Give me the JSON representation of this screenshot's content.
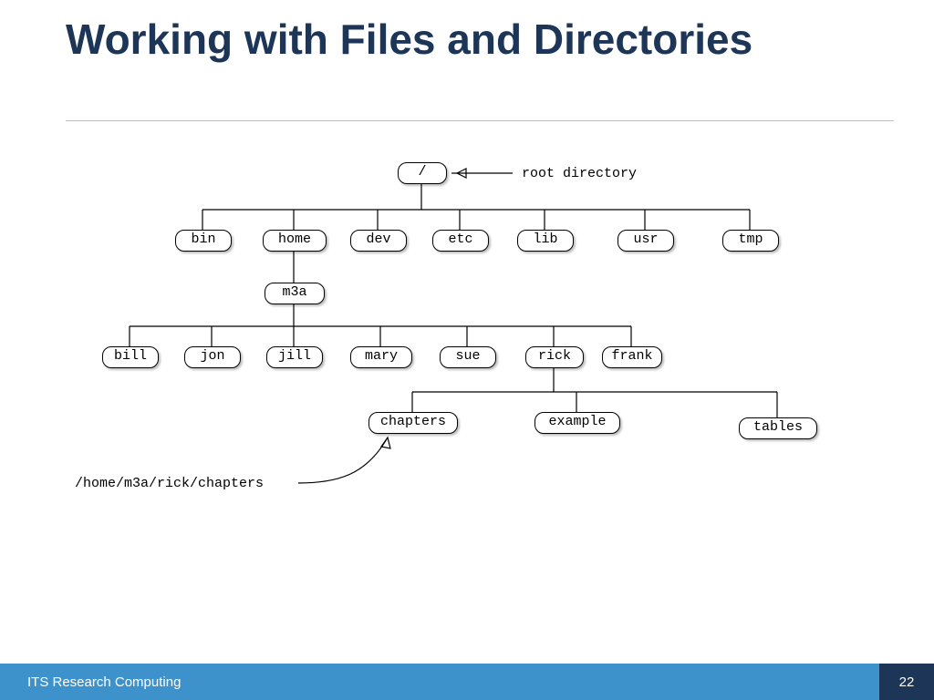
{
  "title": "Working with Files and Directories",
  "footer": {
    "text": "ITS Research Computing",
    "page": "22"
  },
  "diagram": {
    "root_label": "root directory",
    "path_annotation": "/home/m3a/rick/chapters",
    "nodes": {
      "root": "/",
      "bin": "bin",
      "home": "home",
      "dev": "dev",
      "etc": "etc",
      "lib": "lib",
      "usr": "usr",
      "tmp": "tmp",
      "m3a": "m3a",
      "bill": "bill",
      "jon": "jon",
      "jill": "jill",
      "mary": "mary",
      "sue": "sue",
      "rick": "rick",
      "frank": "frank",
      "chapters": "chapters",
      "example": "example",
      "tables": "tables"
    }
  },
  "chart_data": {
    "type": "tree",
    "title": "Unix filesystem directory tree",
    "structure": {
      "name": "/",
      "annotation": "root directory",
      "children": [
        {
          "name": "bin"
        },
        {
          "name": "home",
          "children": [
            {
              "name": "m3a",
              "children": [
                {
                  "name": "bill"
                },
                {
                  "name": "jon"
                },
                {
                  "name": "jill"
                },
                {
                  "name": "mary"
                },
                {
                  "name": "sue"
                },
                {
                  "name": "rick",
                  "children": [
                    {
                      "name": "chapters",
                      "annotation": "/home/m3a/rick/chapters"
                    },
                    {
                      "name": "example"
                    },
                    {
                      "name": "tables"
                    }
                  ]
                },
                {
                  "name": "frank"
                }
              ]
            }
          ]
        },
        {
          "name": "dev"
        },
        {
          "name": "etc"
        },
        {
          "name": "lib"
        },
        {
          "name": "usr"
        },
        {
          "name": "tmp"
        }
      ]
    }
  }
}
